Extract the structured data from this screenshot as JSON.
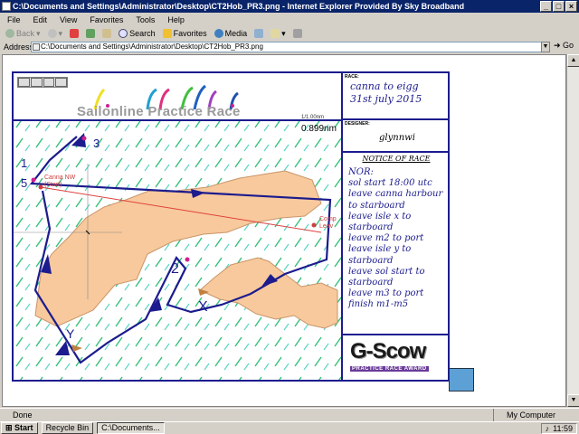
{
  "window": {
    "title": "C:\\Documents and Settings\\Administrator\\Desktop\\CT2Hob_PR3.png - Internet Explorer Provided By Sky Broadband"
  },
  "menu": [
    "File",
    "Edit",
    "View",
    "Favorites",
    "Tools",
    "Help"
  ],
  "toolbar": {
    "back": "Back",
    "search": "Search",
    "favorites": "Favorites",
    "media": "Media"
  },
  "address": {
    "label": "Address",
    "value": "C:\\Documents and Settings\\Administrator\\Desktop\\CT2Hob_PR3.png",
    "go": "Go"
  },
  "page": {
    "banner_text": "Sailonline Practice Race",
    "scale_top": "1/1.00nm",
    "scale_value": "0.899nm",
    "race_label": "RACE:",
    "race_line1": "canna to eigg",
    "race_line2": "31st july 2015",
    "designer_label": "DESIGNER:",
    "designer": "glynnwi",
    "notice_title": "NOTICE OF RACE",
    "notice": [
      "NOR:",
      "sol start 18:00 utc",
      "leave canna harbour",
      "to starboard",
      "leave isle x to",
      "starboard",
      "leave m2 to port",
      "leave isle y to",
      "starboard",
      "leave sol start to",
      "starboard",
      "leave m3 to port",
      "finish m1-m5"
    ],
    "gscow_title": "G-Scow",
    "gscow_sub": "PRACTICE RACE AWARD",
    "map": {
      "marks": {
        "m1": "1",
        "m2": "2",
        "m3": "3",
        "m5": "5",
        "x": "X",
        "y": "Y"
      },
      "start_label": "Canna NW",
      "start_sub": "(Start)",
      "finish_label": "Comp",
      "finish_sub": "Leav"
    }
  },
  "status": {
    "text": "Done",
    "zone": "My Computer"
  },
  "taskbar": {
    "start": "Start",
    "items": [
      "Recycle Bin",
      "C:\\Documents..."
    ],
    "clock": "11:59"
  }
}
